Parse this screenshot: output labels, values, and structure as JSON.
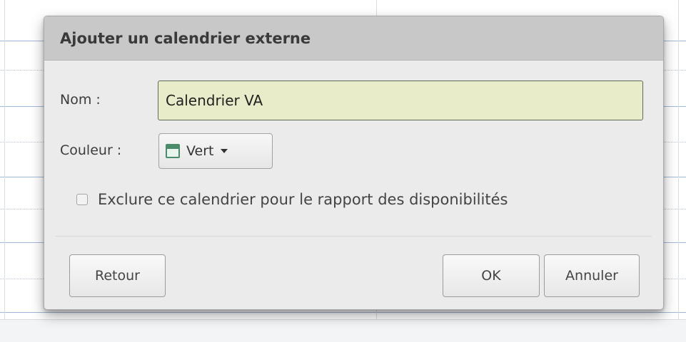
{
  "dialog": {
    "title": "Ajouter un calendrier externe",
    "name_label": "Nom :",
    "name_value": "Calendrier VA",
    "color_label": "Couleur :",
    "color_value": "Vert",
    "color_icon": "calendar-icon",
    "accent_color": "#4a8b6a",
    "exclude_label": "Exclure ce calendrier pour le rapport des disponibilités",
    "exclude_checked": false,
    "buttons": {
      "back": "Retour",
      "ok": "OK",
      "cancel": "Annuler"
    }
  }
}
